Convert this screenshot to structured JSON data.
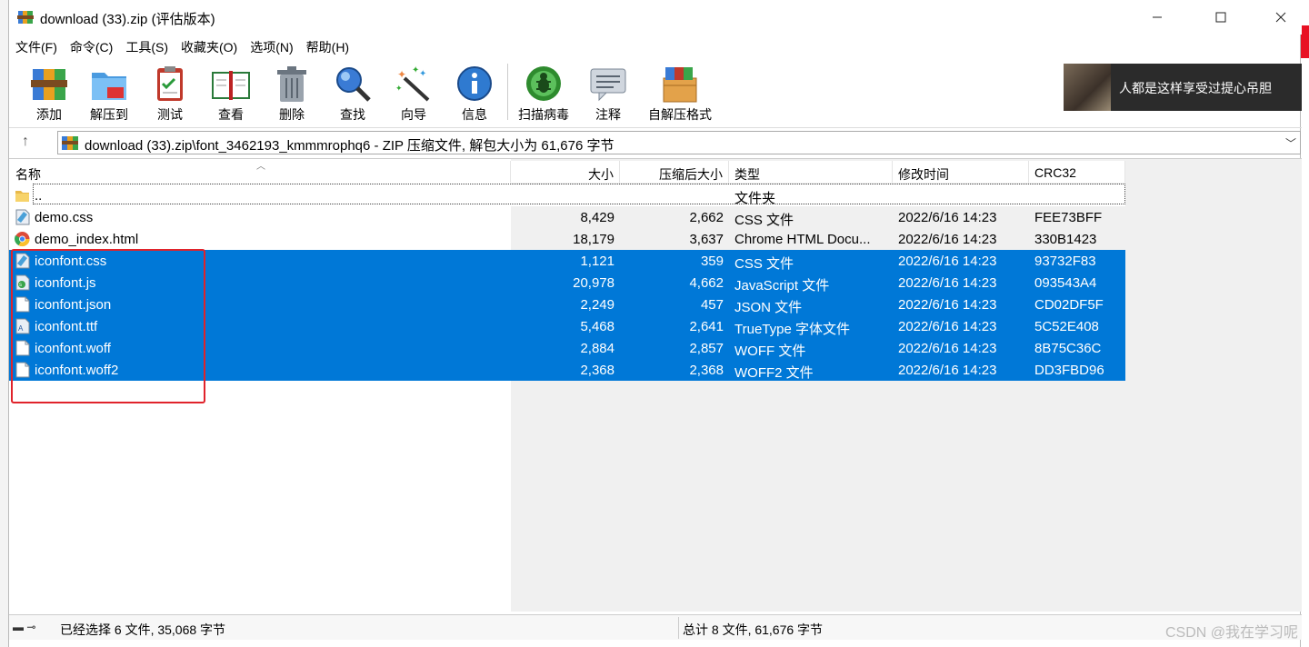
{
  "window": {
    "title": "download (33).zip (评估版本)"
  },
  "menu": [
    "文件(F)",
    "命令(C)",
    "工具(S)",
    "收藏夹(O)",
    "选项(N)",
    "帮助(H)"
  ],
  "toolbar": [
    "添加",
    "解压到",
    "测试",
    "查看",
    "删除",
    "查找",
    "向导",
    "信息",
    "扫描病毒",
    "注释",
    "自解压格式"
  ],
  "ad": {
    "text": "人都是这样享受过提心吊胆"
  },
  "address": {
    "path": "download (33).zip\\font_3462193_kmmmrophq6 - ZIP 压缩文件, 解包大小为 61,676 字节"
  },
  "columns": {
    "name": "名称",
    "size": "大小",
    "packed": "压缩后大小",
    "type": "类型",
    "modified": "修改时间",
    "crc": "CRC32"
  },
  "parent": {
    "name": "..",
    "type": "文件夹"
  },
  "files": [
    {
      "name": "demo.css",
      "size": "8,429",
      "packed": "2,662",
      "type": "CSS 文件",
      "modified": "2022/6/16 14:23",
      "crc": "FEE73BFF",
      "icon": "css-file-icon",
      "selected": false
    },
    {
      "name": "demo_index.html",
      "size": "18,179",
      "packed": "3,637",
      "type": "Chrome HTML Docu...",
      "modified": "2022/6/16 14:23",
      "crc": "330B1423",
      "icon": "chrome-html-icon",
      "selected": false
    },
    {
      "name": "iconfont.css",
      "size": "1,121",
      "packed": "359",
      "type": "CSS 文件",
      "modified": "2022/6/16 14:23",
      "crc": "93732F83",
      "icon": "css-file-icon",
      "selected": true
    },
    {
      "name": "iconfont.js",
      "size": "20,978",
      "packed": "4,662",
      "type": "JavaScript 文件",
      "modified": "2022/6/16 14:23",
      "crc": "093543A4",
      "icon": "js-file-icon",
      "selected": true
    },
    {
      "name": "iconfont.json",
      "size": "2,249",
      "packed": "457",
      "type": "JSON 文件",
      "modified": "2022/6/16 14:23",
      "crc": "CD02DF5F",
      "icon": "file-icon",
      "selected": true
    },
    {
      "name": "iconfont.ttf",
      "size": "5,468",
      "packed": "2,641",
      "type": "TrueType 字体文件",
      "modified": "2022/6/16 14:23",
      "crc": "5C52E408",
      "icon": "font-file-icon",
      "selected": true
    },
    {
      "name": "iconfont.woff",
      "size": "2,884",
      "packed": "2,857",
      "type": "WOFF 文件",
      "modified": "2022/6/16 14:23",
      "crc": "8B75C36C",
      "icon": "file-icon",
      "selected": true
    },
    {
      "name": "iconfont.woff2",
      "size": "2,368",
      "packed": "2,368",
      "type": "WOFF2 文件",
      "modified": "2022/6/16 14:23",
      "crc": "DD3FBD96",
      "icon": "file-icon",
      "selected": true
    }
  ],
  "status": {
    "selected": "已经选择 6 文件, 35,068 字节",
    "total": "总计 8 文件, 61,676 字节"
  },
  "watermark": "CSDN @我在学习呢",
  "colors": {
    "selection": "#0078d7",
    "highlight_box": "#e0232b"
  }
}
